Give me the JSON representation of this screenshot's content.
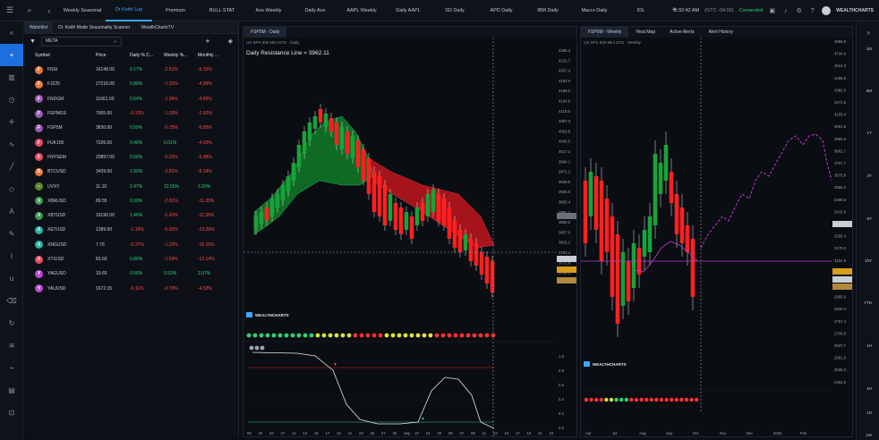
{
  "top": {
    "tabs": [
      "Weekly Seasonal",
      "Dr Keith Lup",
      "Premium",
      "BULL STAT",
      "Aos Weekly",
      "Daily Aos",
      "AAPL Weekly",
      "Daily AAPL",
      "SD Daily",
      "APD Daily",
      "IBM Daily",
      "Macro Daily",
      "IOL"
    ],
    "active_tab": 1,
    "time": "5:32:42 AM",
    "gmt": "(GTC -04:00)",
    "status": "Connected",
    "brand": "WEALTHCHARTS"
  },
  "watchlist": {
    "tabs": [
      "Watchlist",
      "Dr. Keith Mode Seasonality Scanner",
      "WealthChartsTV"
    ],
    "selector": "META",
    "columns": [
      "Symbol",
      "Price",
      "Daily % C...",
      "Weekly %...",
      "Monthly ..."
    ],
    "rows": [
      {
        "letter": "F",
        "symbol": "FNSI",
        "price": "16148.00",
        "d": "0.17%",
        "w": "-2.51%",
        "m": "-6.15%",
        "color": "#e8773a",
        "dpos": true,
        "wpos": false,
        "mpos": false
      },
      {
        "letter": "F",
        "symbol": "FJ225",
        "price": "27216.00",
        "d": "0.86%",
        "w": "-1.32%",
        "m": "-4.89%",
        "color": "#e8773a",
        "dpos": true,
        "wpos": false,
        "mpos": false
      },
      {
        "letter": "F",
        "symbol": "FNDGM",
        "price": "11661.00",
        "d": "0.54%",
        "w": "-1.95%",
        "m": "-4.85%",
        "color": "#9b59b6",
        "dpos": true,
        "wpos": false,
        "mpos": false
      },
      {
        "letter": "F",
        "symbol": "FSPMGS",
        "price": "7665.00",
        "d": "-0.13%",
        "w": "-1.03%",
        "m": "-2.92%",
        "color": "#9b59b6",
        "dpos": false,
        "wpos": false,
        "mpos": false
      },
      {
        "letter": "F",
        "symbol": "FSP5M",
        "price": "3830.00",
        "d": "0.59%",
        "w": "-0.25%",
        "m": "-6.85%",
        "color": "#9b59b6",
        "dpos": true,
        "wpos": false,
        "mpos": false
      },
      {
        "letter": "F",
        "symbol": "FUK100",
        "price": "7226.00",
        "d": "0.46%",
        "w": "0.01%",
        "m": "-4.93%",
        "color": "#e84a5f",
        "dpos": true,
        "wpos": true,
        "mpos": false
      },
      {
        "letter": "F",
        "symbol": "FNYSEM",
        "price": "20857.00",
        "d": "0.56%",
        "w": "-0.01%",
        "m": "-5.98%",
        "color": "#e84a5f",
        "dpos": true,
        "wpos": false,
        "mpos": false
      },
      {
        "letter": "B",
        "symbol": "BTCUSD",
        "price": "3439.00",
        "d": "1.90%",
        "w": "-3.81%",
        "m": "-5.14%",
        "color": "#e8773a",
        "dpos": true,
        "wpos": false,
        "mpos": false
      },
      {
        "letter": "~",
        "symbol": "UVXY",
        "price": "11.10",
        "d": "2.47%",
        "w": "12.55%",
        "m": "3.20%",
        "color": "#5b8a2e",
        "dpos": true,
        "wpos": true,
        "mpos": true
      },
      {
        "letter": "X",
        "symbol": "XBRUSD",
        "price": "89.55",
        "d": "0.90%",
        "w": "-2.81%",
        "m": "-11.35%",
        "color": "#3a9a56",
        "dpos": true,
        "wpos": false,
        "mpos": false
      },
      {
        "letter": "X",
        "symbol": "XBTUSD",
        "price": "19190.00",
        "d": "1.46%",
        "w": "-2.60%",
        "m": "-11.36%",
        "color": "#3a9a56",
        "dpos": true,
        "wpos": false,
        "mpos": false
      },
      {
        "letter": "X",
        "symbol": "XETUSD",
        "price": "1289.00",
        "d": "-1.16%",
        "w": "-6.92%",
        "m": "-23.39%",
        "color": "#2bb3a3",
        "dpos": false,
        "wpos": false,
        "mpos": false
      },
      {
        "letter": "X",
        "symbol": "XNGUSD",
        "price": "7.76",
        "d": "-0.37%",
        "w": "-1.22%",
        "m": "-16.15%",
        "color": "#2bb3a3",
        "dpos": false,
        "wpos": false,
        "mpos": false
      },
      {
        "letter": "X",
        "symbol": "XTIUSD",
        "price": "83.60",
        "d": "0.80%",
        "w": "-1.50%",
        "m": "-12.14%",
        "color": "#e84a5f",
        "dpos": true,
        "wpos": false,
        "mpos": false
      },
      {
        "letter": "Y",
        "symbol": "YAGUSD",
        "price": "19.60",
        "d": "0.56%",
        "w": "0.53%",
        "m": "2.07%",
        "color": "#b84bd1",
        "dpos": true,
        "wpos": true,
        "mpos": true
      },
      {
        "letter": "Y",
        "symbol": "YAUUSD",
        "price": "1672.15",
        "d": "-0.11%",
        "w": "-0.70%",
        "m": "-4.53%",
        "color": "#b84bd1",
        "dpos": false,
        "wpos": false,
        "mpos": false
      }
    ]
  },
  "left_chart": {
    "tab": "FSP5M - Daily",
    "symbol_line": "US SPX 500 Mini CFD · Daily",
    "resistance": "Daily Resistance Line = 3962.11",
    "brand": "WEALTHCHARTS",
    "price_ticks": [
      "4256.3",
      "4231.7",
      "4207.4",
      "4183.6",
      "4158.6",
      "4134.6",
      "4110.9",
      "4087.3",
      "4063.8",
      "4040.5",
      "4017.2",
      "3994.1",
      "3971.2",
      "3948.5",
      "3925.9",
      "3903.4",
      "3881.1",
      "3859.0",
      "3837.0",
      "3815.1",
      "3793.4",
      "3771.8",
      "3750.3"
    ],
    "time_ticks": [
      "08",
      "20",
      "26",
      "27",
      "12",
      "13",
      "15",
      "17",
      "19",
      "21",
      "23",
      "25",
      "27",
      "29",
      "Sep",
      "27",
      "01",
      "03",
      "05",
      "07",
      "09",
      "11",
      "13",
      "15",
      "17",
      "19",
      "21",
      "23"
    ],
    "osc_ticks": [
      "1.0",
      "0.8",
      "0.6",
      "0.4",
      "0.2",
      "0.0"
    ]
  },
  "right_chart": {
    "tabs": [
      "FSP5M - Weekly",
      "Heat Map",
      "Active Alerts",
      "Alert History"
    ],
    "symbol_line": "US SPX 500 Mini CFD · Weekly",
    "brand": "WEALTHCHARTS",
    "price_ticks": [
      "4859.5",
      "4734.9",
      "4614.0",
      "4496.6",
      "4382.9",
      "4272.5",
      "4165.4",
      "4061.5",
      "3960.6",
      "3862.7",
      "3767.7",
      "3675.6",
      "3586.2",
      "3499.6",
      "3415.6",
      "3334.2",
      "3255.4",
      "3179.0",
      "3104.9",
      "3032.9",
      "2963.1",
      "2895.6",
      "2830.4",
      "2767.4",
      "2706.5",
      "2647.7",
      "2591.0",
      "2536.3",
      "2483.6"
    ],
    "time_ticks": [
      "Apr",
      "Jul",
      "Aug",
      "Sep",
      "Oct",
      "Nov",
      "Dec",
      "2023",
      "Feb"
    ],
    "right_labels": [
      "1M",
      "6M",
      "1Y",
      "3Y",
      "5Y",
      "10Y",
      "YTD",
      "1H",
      "4H",
      "1D",
      "1W"
    ]
  }
}
